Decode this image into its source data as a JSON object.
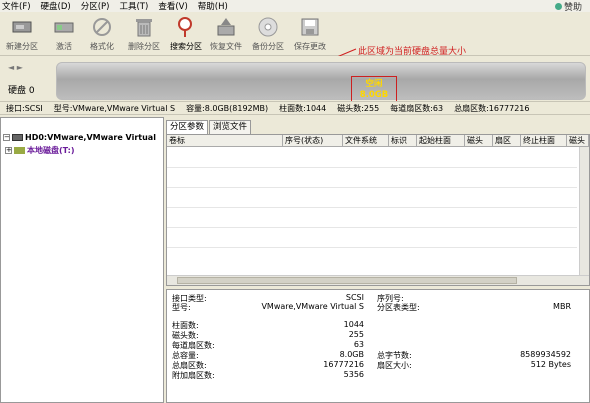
{
  "menu": {
    "items": [
      "文件(F)",
      "硬盘(D)",
      "分区(P)",
      "工具(T)",
      "查看(V)",
      "帮助(H)"
    ],
    "sponsor": "赞助"
  },
  "toolbar": {
    "buttons": [
      "新建分区",
      "激活",
      "格式化",
      "删除分区",
      "搜索分区",
      "恢复文件",
      "备份分区",
      "保存更改"
    ]
  },
  "annotation": {
    "text": "此区域为当前硬盘总量大小"
  },
  "disk": {
    "label": "硬盘 0",
    "free_label": "空闲",
    "free_size": "8.0GB"
  },
  "info": {
    "interface": "接口:SCSI",
    "model": "型号:VMware,VMware Virtual S",
    "capacity": "容量:8.0GB(8192MB)",
    "cylinders": "柱面数:1044",
    "heads": "磁头数:255",
    "sectors_per_track": "每道扇区数:63",
    "total_sectors": "总扇区数:16777216"
  },
  "tree": {
    "hd0": "HD0:VMware,VMware Virtual",
    "local_disk": "本地磁盘(T:)"
  },
  "tabs": [
    "分区参数",
    "浏览文件"
  ],
  "grid_columns": [
    "卷标",
    "序号(状态)",
    "文件系统",
    "标识",
    "起始柱面",
    "磁头",
    "扇区",
    "终止柱面",
    "磁头"
  ],
  "details": {
    "interface_type_label": "接口类型:",
    "interface_type_value": "SCSI",
    "model_label": "型号:",
    "model_value": "VMware,VMware Virtual S",
    "serial_label": "序列号:",
    "partition_table_label": "分区表类型:",
    "partition_table_value": "MBR",
    "cylinders_label": "柱面数:",
    "cylinders_value": "1044",
    "heads_label": "磁头数:",
    "heads_value": "255",
    "spt_label": "每道扇区数:",
    "spt_value": "63",
    "capacity_label": "总容量:",
    "capacity_value": "8.0GB",
    "total_bytes_label": "总字节数:",
    "total_bytes_value": "8589934592",
    "total_sectors_label": "总扇区数:",
    "total_sectors_value": "16777216",
    "sector_size_label": "扇区大小:",
    "sector_size_value": "512 Bytes",
    "extra_sectors_label": "附加扇区数:",
    "extra_sectors_value": "5356"
  }
}
